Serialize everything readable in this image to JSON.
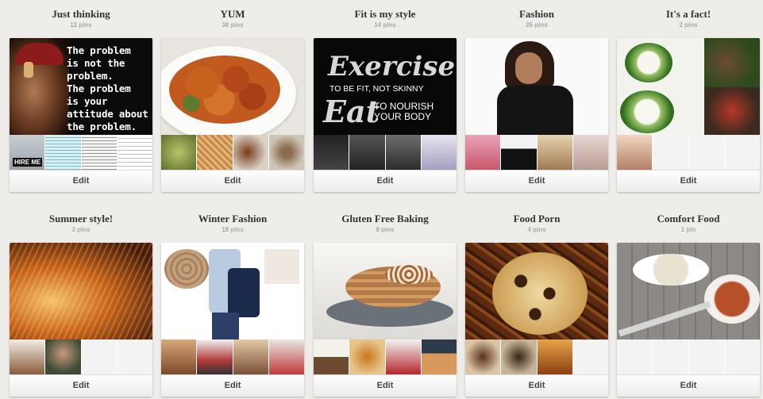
{
  "boards": [
    {
      "title": "Just thinking",
      "pins": "12 pins",
      "edit_label": "Edit",
      "cover": {
        "quote": "The problem\nis not the\nproblem.\nThe problem\nis your\nattitude about\nthe problem."
      },
      "thumb_text": [
        "HIRE ME",
        "",
        "",
        "",
        ""
      ]
    },
    {
      "title": "YUM",
      "pins": "38 pins",
      "edit_label": "Edit"
    },
    {
      "title": "Fit is my style",
      "pins": "14 pins",
      "edit_label": "Edit",
      "cover": {
        "line1": "Exercise",
        "line2": "TO BE FIT, NOT SKINNY",
        "line3": "Eat",
        "line4": "TO NOURISH\nYOUR BODY"
      }
    },
    {
      "title": "Fashion",
      "pins": "26 pins",
      "edit_label": "Edit"
    },
    {
      "title": "It's a fact!",
      "pins": "2 pins",
      "edit_label": "Edit"
    },
    {
      "title": "Summer style!",
      "pins": "3 pins",
      "edit_label": "Edit"
    },
    {
      "title": "Winter Fashion",
      "pins": "18 pins",
      "edit_label": "Edit"
    },
    {
      "title": "Gluten Free Baking",
      "pins": "8 pins",
      "edit_label": "Edit"
    },
    {
      "title": "Food Porn",
      "pins": "4 pins",
      "edit_label": "Edit"
    },
    {
      "title": "Comfort Food",
      "pins": "1 pin",
      "edit_label": "Edit"
    }
  ]
}
